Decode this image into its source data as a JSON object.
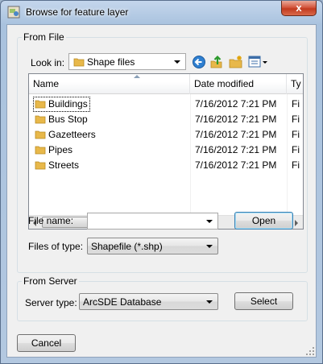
{
  "window": {
    "title": "Browse for feature layer",
    "close_label": "x"
  },
  "from_file": {
    "group_label": "From File",
    "look_in_label": "Look in:",
    "look_in_value": "Shape files",
    "toolbar_icons": [
      "back-icon",
      "up-folder-icon",
      "new-folder-icon",
      "view-menu-icon"
    ],
    "columns": [
      "Name",
      "Date modified",
      "Ty"
    ],
    "rows": [
      {
        "name": "Buildings",
        "date": "7/16/2012 7:21 PM",
        "type": "Fi"
      },
      {
        "name": "Bus Stop",
        "date": "7/16/2012 7:21 PM",
        "type": "Fi"
      },
      {
        "name": "Gazetteers",
        "date": "7/16/2012 7:21 PM",
        "type": "Fi"
      },
      {
        "name": "Pipes",
        "date": "7/16/2012 7:21 PM",
        "type": "Fi"
      },
      {
        "name": "Streets",
        "date": "7/16/2012 7:21 PM",
        "type": "Fi"
      }
    ],
    "file_name_label": "File name:",
    "file_name_value": "",
    "open_label": "Open",
    "files_of_type_label": "Files of type:",
    "files_of_type_value": "Shapefile (*.shp)"
  },
  "from_server": {
    "group_label": "From Server",
    "server_type_label": "Server type:",
    "server_type_value": "ArcSDE Database",
    "select_label": "Select"
  },
  "cancel_label": "Cancel",
  "colors": {
    "accent": "#3c7fb1",
    "folder": "#e8b84a",
    "close": "#c23a1f"
  }
}
